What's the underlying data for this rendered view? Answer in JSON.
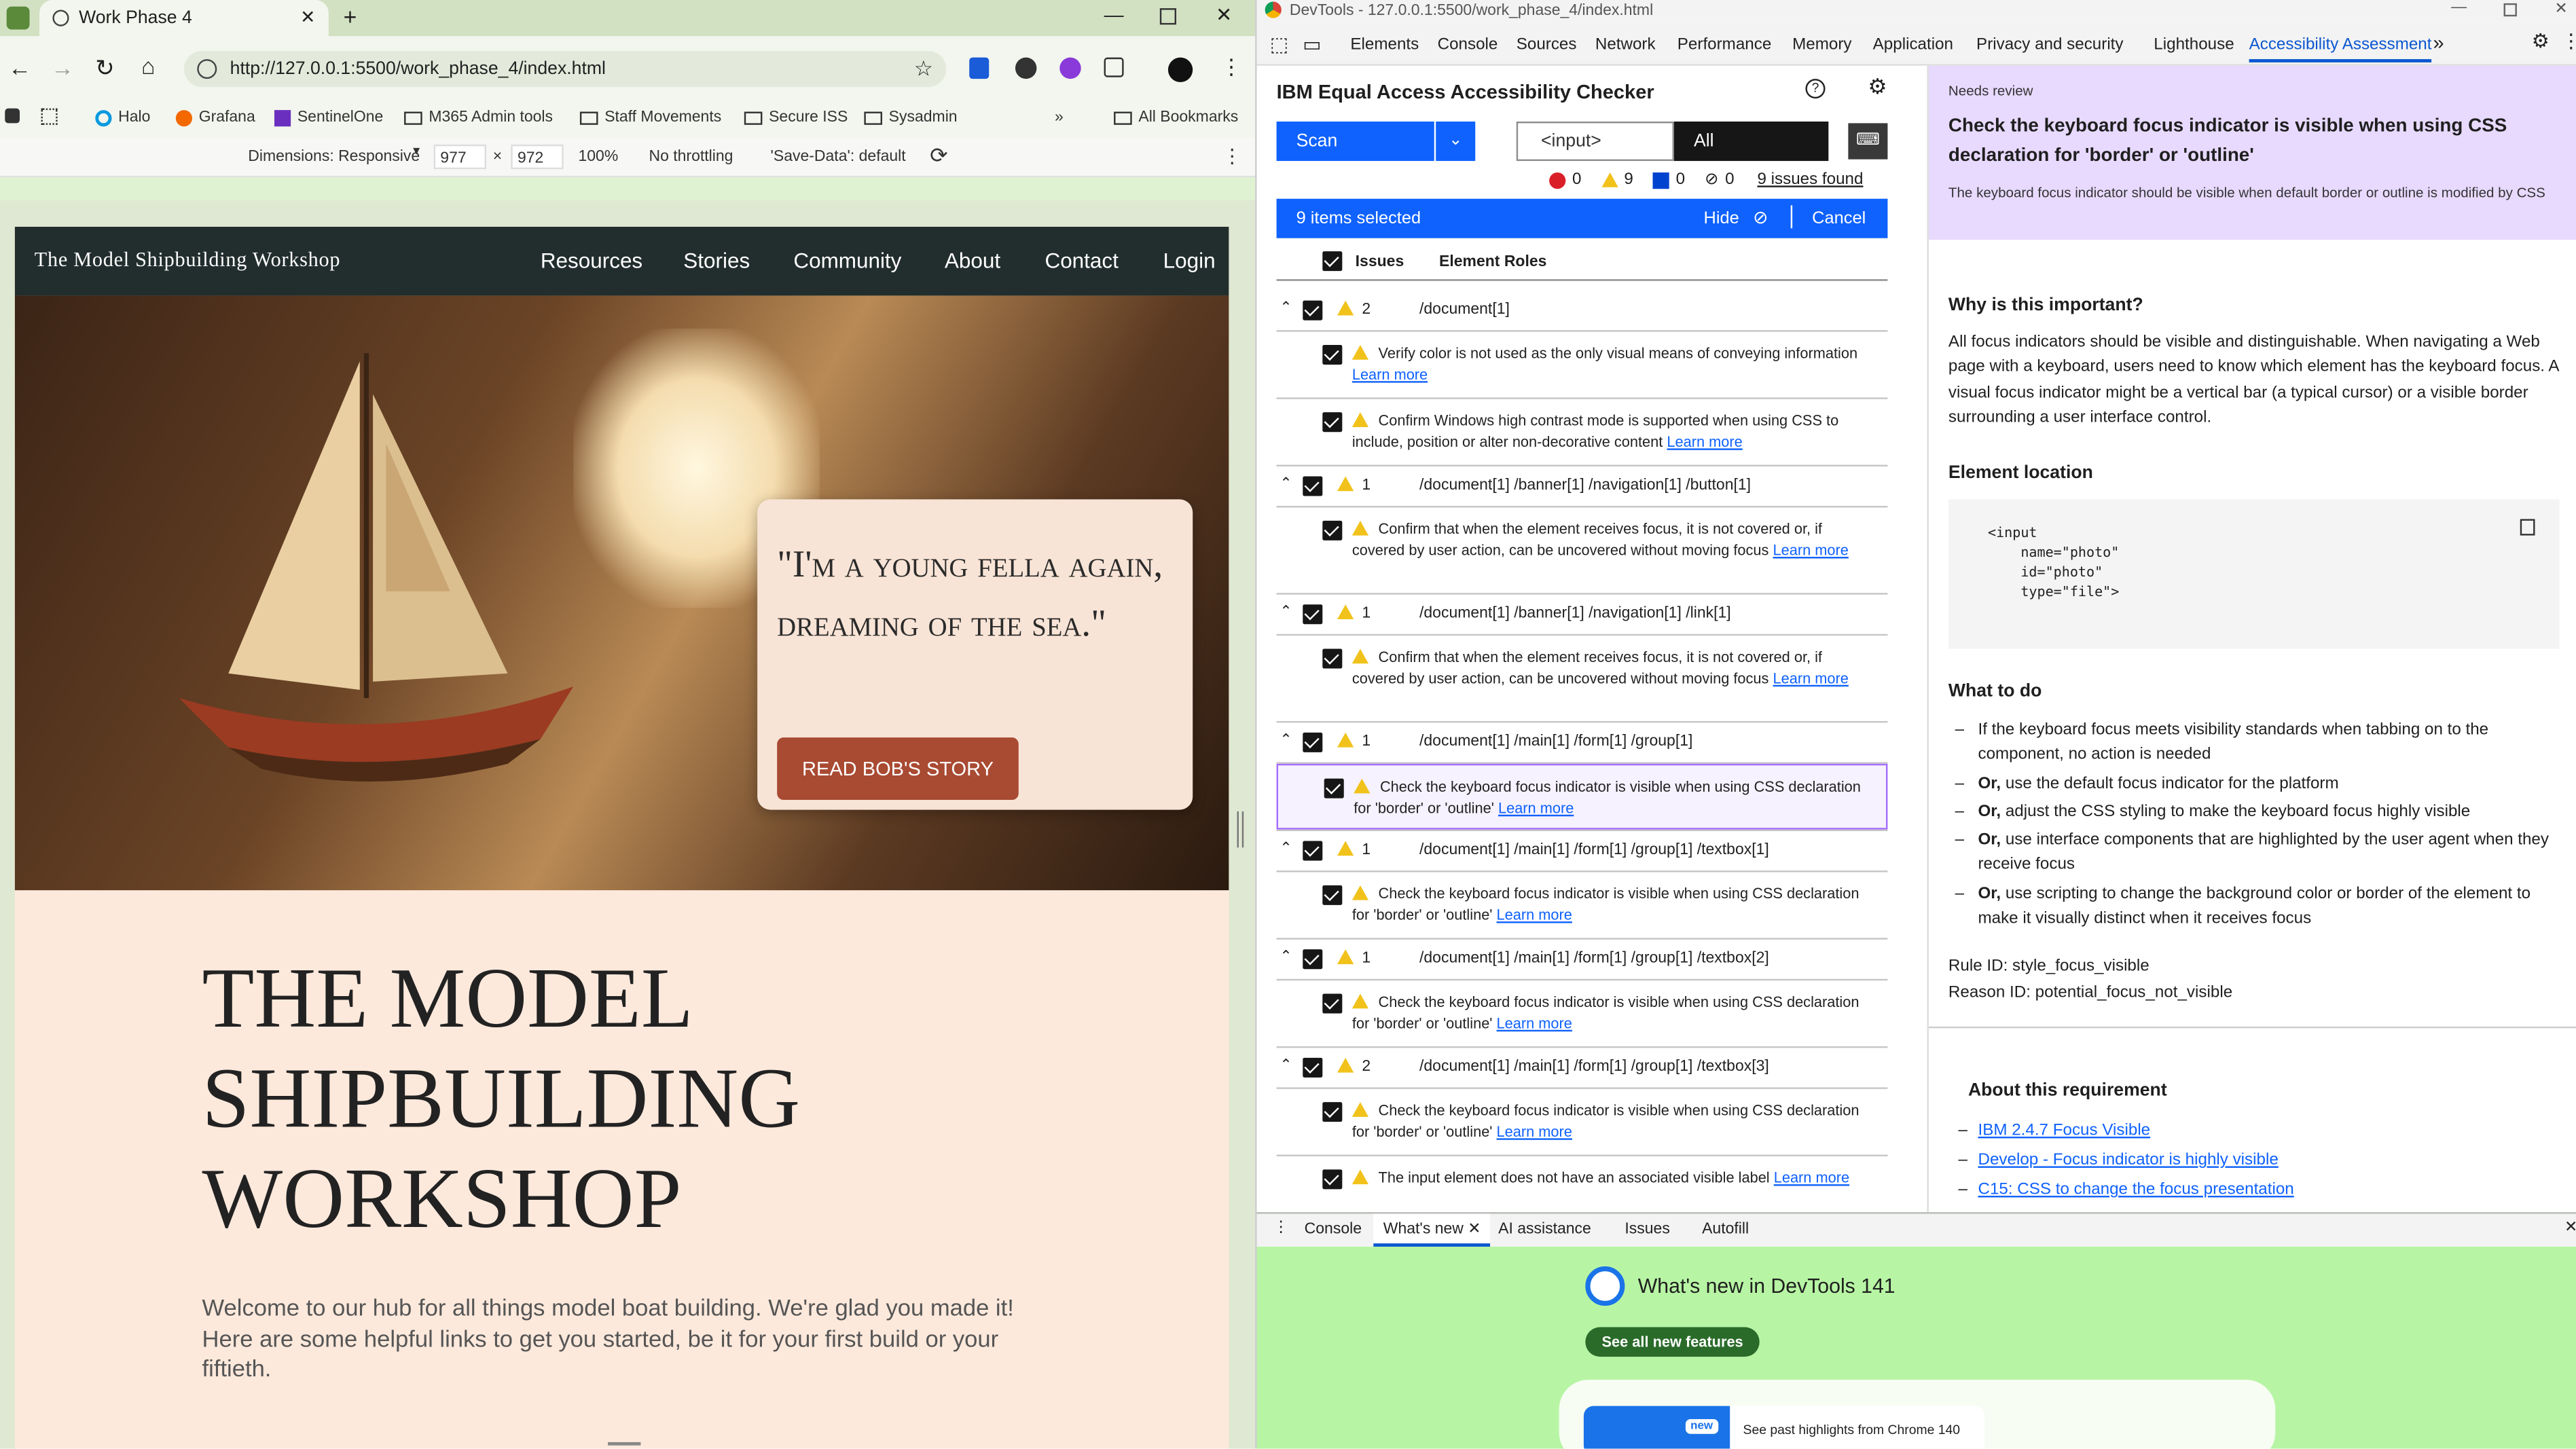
{
  "browser": {
    "tab_title": "Work Phase 4",
    "url": "http://127.0.0.1:5500/work_phase_4/index.html",
    "bookmarks": [
      "Halo",
      "Grafana",
      "SentinelOne",
      "M365 Admin tools",
      "Staff Movements",
      "Secure ISS",
      "Sysadmin",
      "All Bookmarks"
    ],
    "device_toolbar": {
      "dimensions": "Dimensions: Responsive",
      "width": "977",
      "height": "972",
      "zoom": "100%",
      "throttle": "No throttling",
      "save_data": "'Save-Data': default"
    }
  },
  "site": {
    "logo": "The Model Shipbuilding Workshop",
    "nav": [
      "Resources",
      "Stories",
      "Community",
      "About",
      "Contact",
      "Login"
    ],
    "quote": "\"I'm a young fella again, dreaming of the sea.\"",
    "cta": "READ BOB'S STORY",
    "heading": "THE MODEL SHIPBUILDING WORKSHOP",
    "intro": "Welcome to our hub for all things model boat building. We're glad you made it! Here are some helpful links to get you started, be it for your first build or your fiftieth."
  },
  "devtools": {
    "window_title": "DevTools - 127.0.0.1:5500/work_phase_4/index.html",
    "tabs": [
      "Elements",
      "Console",
      "Sources",
      "Network",
      "Performance",
      "Memory",
      "Application",
      "Privacy and security",
      "Lighthouse",
      "Accessibility Assessment"
    ],
    "checker": {
      "title": "IBM Equal Access Accessibility Checker",
      "scan": "Scan",
      "filter_placeholder": "<input>",
      "filter_all": "All",
      "counts": {
        "violations": "0",
        "needs_review": "9",
        "recommendations": "0",
        "hidden": "0",
        "issues_found": "9 issues found"
      },
      "selection": {
        "text": "9 items selected",
        "hide": "Hide",
        "cancel": "Cancel"
      },
      "columns": {
        "issues": "Issues",
        "roles": "Element Roles"
      },
      "groups": [
        {
          "count": "2",
          "path": "/document[1]",
          "issues": [
            "Verify color is not used as the only visual means of conveying information",
            "Confirm Windows high contrast mode is supported when using CSS to include, position or alter non-decorative content"
          ]
        },
        {
          "count": "1",
          "path": "/document[1] /banner[1] /navigation[1] /button[1]",
          "issues": [
            "Confirm that when the element receives focus, it is not covered or, if covered by user action, can be uncovered without moving focus"
          ]
        },
        {
          "count": "1",
          "path": "/document[1] /banner[1] /navigation[1] /link[1]",
          "issues": [
            "Confirm that when the element receives focus, it is not covered or, if covered by user action, can be uncovered without moving focus"
          ]
        },
        {
          "count": "1",
          "path": "/document[1] /main[1] /form[1] /group[1]",
          "issues": [
            "Check the keyboard focus indicator is visible when using CSS declaration for 'border' or 'outline'"
          ]
        },
        {
          "count": "1",
          "path": "/document[1] /main[1] /form[1] /group[1] /textbox[1]",
          "issues": [
            "Check the keyboard focus indicator is visible when using CSS declaration for 'border' or 'outline'"
          ]
        },
        {
          "count": "1",
          "path": "/document[1] /main[1] /form[1] /group[1] /textbox[2]",
          "issues": [
            "Check the keyboard focus indicator is visible when using CSS declaration for 'border' or 'outline'"
          ]
        },
        {
          "count": "2",
          "path": "/document[1] /main[1] /form[1] /group[1] /textbox[3]",
          "issues": [
            "Check the keyboard focus indicator is visible when using CSS declaration for 'border' or 'outline'",
            "The input element does not have an associated visible label"
          ]
        }
      ],
      "learn_more": "Learn more"
    },
    "detail": {
      "level": "Needs review",
      "title": "Check the keyboard focus indicator is visible when using CSS declaration for 'border' or 'outline'",
      "subtitle": "The keyboard focus indicator should be visible when default border or outline is modified by CSS",
      "why_heading": "Why is this important?",
      "why_text": "All focus indicators should be visible and distinguishable. When navigating a Web page with a keyboard, users need to know which element has the keyboard focus. A visual focus indicator might be a vertical bar (a typical cursor) or a visible border surrounding a user interface control.",
      "location_heading": "Element location",
      "code": [
        "<input",
        "    name=\"photo\"",
        "    id=\"photo\"",
        "    type=\"file\">"
      ],
      "todo_heading": "What to do",
      "todo": [
        [
          "",
          "If the keyboard focus meets visibility standards when tabbing on to the component, no action is needed"
        ],
        [
          "Or,",
          "use the default focus indicator for the platform"
        ],
        [
          "Or,",
          "adjust the CSS styling to make the keyboard focus highly visible"
        ],
        [
          "Or,",
          "use interface components that are highlighted by the user agent when they receive focus"
        ],
        [
          "Or,",
          "use scripting to change the background color or border of the element to make it visually distinct when it receives focus"
        ]
      ],
      "rule_id": "Rule ID: style_focus_visible",
      "reason_id": "Reason ID: potential_focus_not_visible",
      "about_heading": "About this requirement",
      "links": [
        "IBM 2.4.7 Focus Visible",
        "Develop - Focus indicator is highly visible",
        "C15: CSS to change the focus presentation"
      ]
    },
    "drawer": {
      "tabs": [
        "Console",
        "What's new",
        "AI assistance",
        "Issues",
        "Autofill"
      ],
      "headline": "What's new in DevTools 141",
      "button": "See all new features",
      "card": "See past highlights from Chrome 140",
      "badge": "new"
    }
  },
  "colors": {
    "accent": "#0f62fe",
    "needs_review_bg": "#e8daff",
    "nav_bg": "#222e2d",
    "cta": "#a94a32",
    "page_bg": "#fde9dc"
  }
}
